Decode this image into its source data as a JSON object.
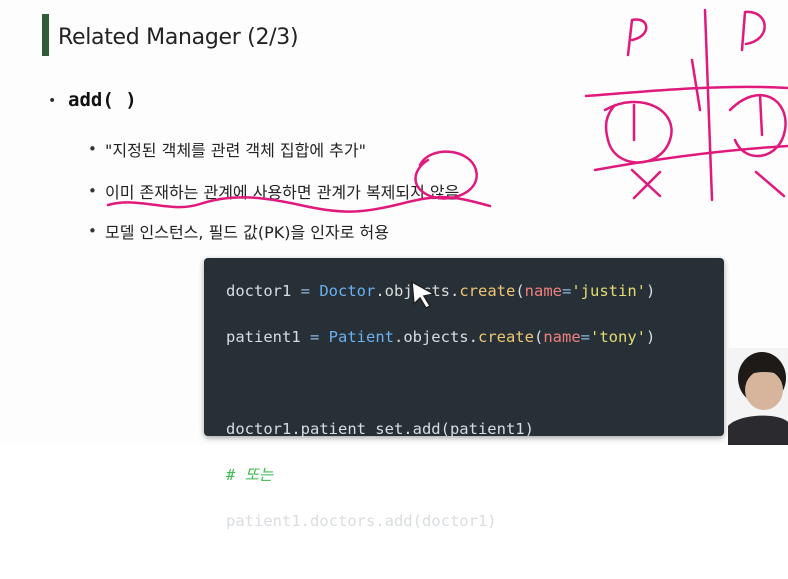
{
  "slide": {
    "title": "Related Manager (2/3)",
    "heading": "add( )",
    "bullets": [
      "\"지정된 객체를 관련 객체 집합에 추가\"",
      "이미 존재하는 관계에 사용하면 관계가 복제되지 않음",
      "모델 인스턴스, 필드 값(PK)을 인자로 허용"
    ]
  },
  "code": {
    "lines": {
      "l1": {
        "var": "doctor1",
        "eq": " = ",
        "cls": "Doctor",
        "mid": ".objects.",
        "fn": "create",
        "p1": "(",
        "kw": "name",
        "eq2": "=",
        "str": "'justin'",
        "p2": ")"
      },
      "l2": {
        "var": "patient1",
        "eq": " = ",
        "cls": "Patient",
        "mid": ".objects.",
        "fn": "create",
        "p1": "(",
        "kw": "name",
        "eq2": "=",
        "str": "'tony'",
        "p2": ")"
      },
      "l4": "doctor1.patient_set.add(patient1)",
      "l5": "# 또는",
      "l6": "patient1.doctors.add(doctor1)"
    }
  },
  "colors": {
    "title_bar": "#2f5d3a",
    "code_bg": "#263036",
    "ink": "#e0197d"
  }
}
